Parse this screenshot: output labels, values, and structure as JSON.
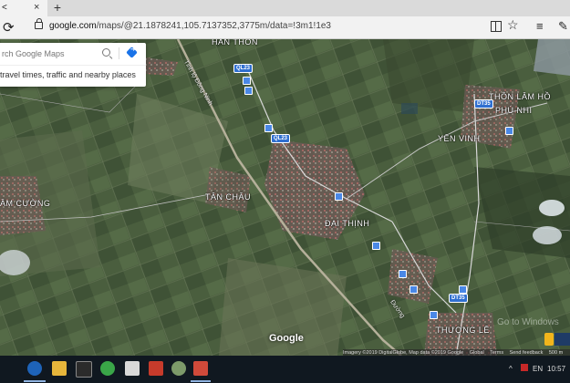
{
  "browser": {
    "tab_title": "<",
    "tab_close": "×",
    "new_tab": "+",
    "refresh_icon": "⟳",
    "url_host": "google.com",
    "url_path": "/maps/@21.1878241,105.7137352,3775m/data=!3m1!1e3",
    "star_icon": "☆",
    "hub_icon": "≡",
    "note_icon": "✎"
  },
  "search": {
    "placeholder": "rch Google Maps",
    "hint": "travel times, traffic and nearby places"
  },
  "map": {
    "places": {
      "han_thon": "HÂN THÔN",
      "thon_lam_ho": "THÔN LÂM HỒ",
      "phu_nhi": "PHÚ NHI",
      "yen_vinh": "YÊN VINH",
      "am_cuong": "ÂM CƯỜNG",
      "tan_chau": "TÂN CHÂU",
      "dai_thinh": "ĐẠI THỊNH",
      "thuong_le": "THƯỢNG LÊ"
    },
    "roads": {
      "quoc_lo_1": "Tỉnh lộ Đông Ninh",
      "road_2": "Đường"
    },
    "shields": [
      "QL23",
      "QL23",
      "DT35",
      "DT35"
    ],
    "google_logo": "Google",
    "attribution": [
      "Imagery ©2019 DigitalGlobe, Map data ©2019 Google",
      "Global",
      "Terms",
      "Send feedback",
      "500 m"
    ],
    "watermark": "Go to Windows"
  },
  "taskbar": {
    "tray_items": [
      "^",
      "EN",
      "10:57"
    ]
  }
}
